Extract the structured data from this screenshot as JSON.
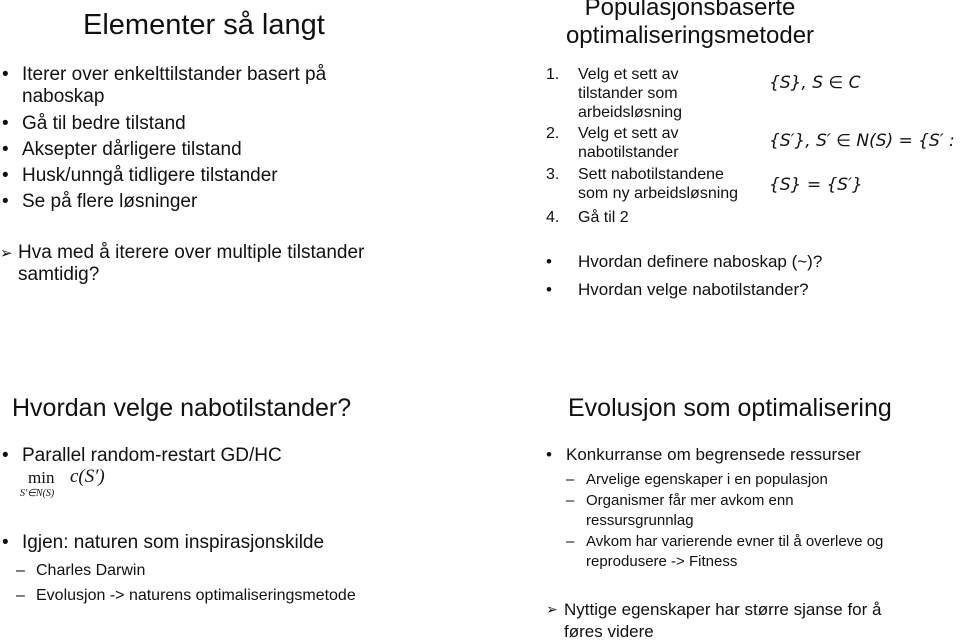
{
  "slides": [
    {
      "title": "Elementer så langt",
      "bullets": [
        {
          "text": "Iterer over enkelttilstander basert på",
          "cont": "naboskap"
        },
        {
          "text": "Gå til bedre tilstand"
        },
        {
          "text": "Aksepter dårligere tilstand"
        },
        {
          "text": "Husk/unngå tidligere tilstander"
        },
        {
          "text": "Se på flere løsninger"
        }
      ],
      "arrow_item": {
        "text": "Hva med å iterere over multiple tilstander",
        "cont": "samtidig?"
      },
      "bullet_glyph": "•",
      "arrow_glyph": "➢"
    },
    {
      "title_line1": "Populasjonsbaserte",
      "title_line2": "optimaliseringsmetoder",
      "steps": [
        {
          "num": "1.",
          "lines": [
            "Velg et sett av",
            "tilstander som",
            "arbeidsløsning"
          ],
          "formula": "{S}, S ∈ C"
        },
        {
          "num": "2.",
          "lines": [
            "Velg et sett av",
            "nabotilstander"
          ],
          "formula": "{S′}, S′ ∈ N(S) = {S′ : S ~ S′}"
        },
        {
          "num": "3.",
          "lines": [
            "Sett nabotilstandene",
            "som ny arbeidsløsning"
          ],
          "formula": "{S} = {S′}"
        },
        {
          "num": "4.",
          "lines": [
            "Gå til 2"
          ],
          "formula": ""
        }
      ],
      "questions": [
        "Hvordan definere naboskap (~)?",
        "Hvordan velge nabotilstander?"
      ]
    },
    {
      "title": "Hvordan velge nabotilstander?",
      "bullet1": "Parallel random-restart GD/HC",
      "formula": {
        "op": "min",
        "sub": "S′∈N(S)",
        "expr": "c(S′)"
      },
      "bullet2": "Igjen: naturen som inspirasjonskilde",
      "subitems": [
        "Charles Darwin",
        "Evolusjon -> naturens optimaliseringsmetode"
      ]
    },
    {
      "title": "Evolusjon som optimalisering",
      "bullet1": "Konkurranse om begrensede ressurser",
      "subitems": [
        {
          "text": "Arvelige egenskaper i en populasjon"
        },
        {
          "text": "Organismer får mer avkom enn",
          "cont": "ressursgrunnlag"
        },
        {
          "text": "Avkom har varierende evner til å overleve og",
          "cont": "reprodusere -> Fitness"
        }
      ],
      "arrow_item": {
        "text": "Nyttige egenskaper har større sjanse for å",
        "cont": "føres videre"
      }
    }
  ],
  "glyphs": {
    "bullet": "•",
    "dash": "–",
    "arrow": "➢"
  }
}
